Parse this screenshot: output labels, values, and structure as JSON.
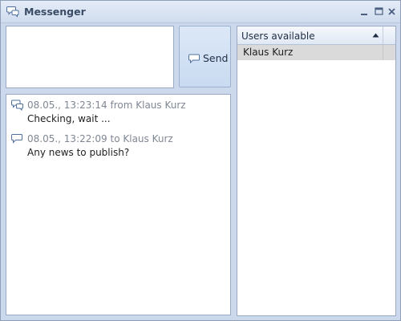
{
  "window": {
    "title": "Messenger",
    "title_icon": "chat-bubbles-icon",
    "controls": [
      "minimize-icon",
      "maximize-icon",
      "close-icon"
    ]
  },
  "compose": {
    "value": "",
    "send_label": "Send",
    "send_icon": "speech-bubble-icon"
  },
  "messages": [
    {
      "icon": "chat-bubbles-icon",
      "meta": "08.05., 13:23:14 from Klaus Kurz",
      "text": "Checking, wait ..."
    },
    {
      "icon": "speech-bubble-icon",
      "meta": "08.05., 13:22:09 to Klaus Kurz",
      "text": "Any news to publish?"
    }
  ],
  "users": {
    "header": "Users available",
    "sort": "ascending",
    "items": [
      "Klaus Kurz"
    ]
  },
  "colors": {
    "window_bg": "#ccd9ec",
    "selected_row": "#dadada",
    "meta_text": "#7f8794"
  }
}
